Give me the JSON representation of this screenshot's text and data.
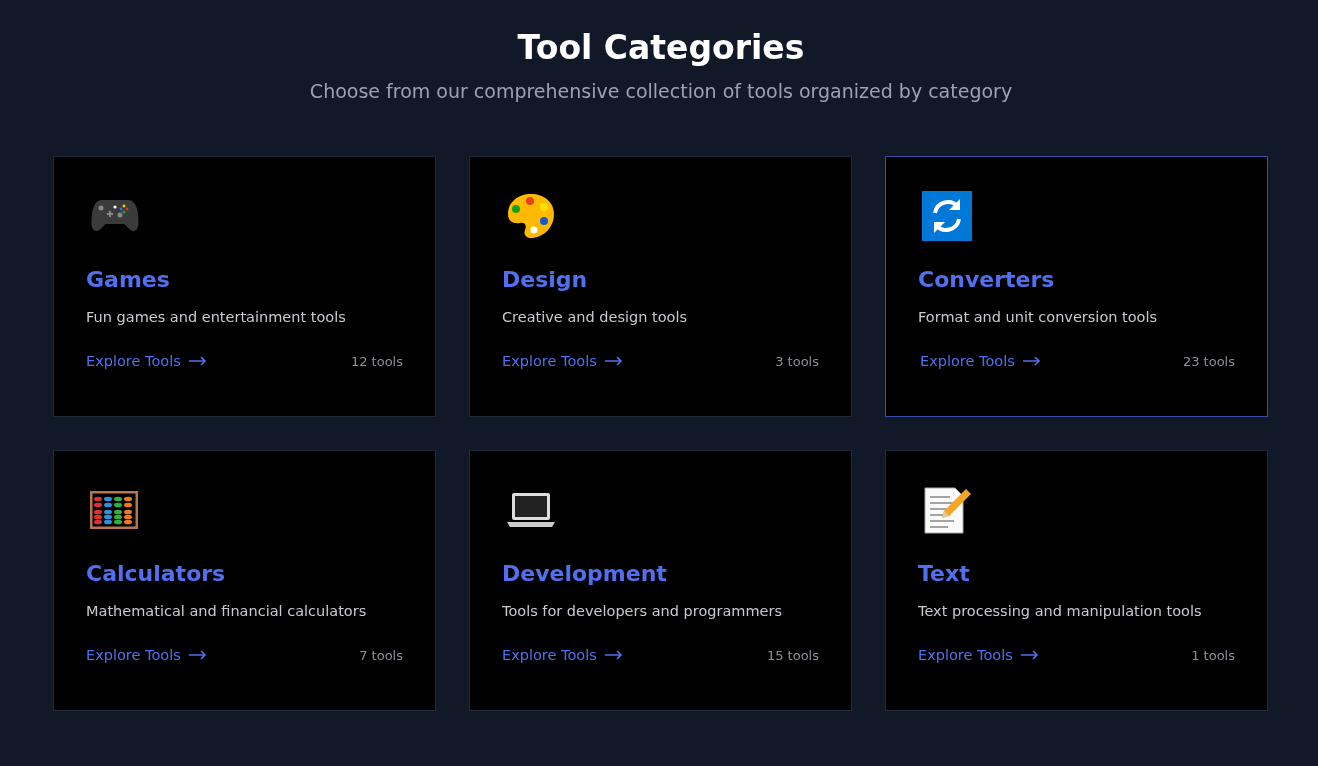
{
  "header": {
    "title": "Tool Categories",
    "subtitle": "Choose from our comprehensive collection of tools organized by category"
  },
  "categories": [
    {
      "kind": "gamepad",
      "name": "Games",
      "description": "Fun games and entertainment tools",
      "link": "Explore Tools",
      "count": "12 tools",
      "highlighted": false
    },
    {
      "kind": "palette",
      "name": "Design",
      "description": "Creative and design tools",
      "link": "Explore Tools",
      "count": "3 tools",
      "highlighted": false
    },
    {
      "kind": "sync",
      "name": "Converters",
      "description": "Format and unit conversion tools",
      "link": "Explore Tools",
      "count": "23 tools",
      "highlighted": true
    },
    {
      "kind": "abacus",
      "name": "Calculators",
      "description": "Mathematical and financial calculators",
      "link": "Explore Tools",
      "count": "7 tools",
      "highlighted": false
    },
    {
      "kind": "laptop",
      "name": "Development",
      "description": "Tools for developers and programmers",
      "link": "Explore Tools",
      "count": "15 tools",
      "highlighted": false
    },
    {
      "kind": "memo",
      "name": "Text",
      "description": "Text processing and manipulation tools",
      "link": "Explore Tools",
      "count": "1 tools",
      "highlighted": false
    }
  ]
}
